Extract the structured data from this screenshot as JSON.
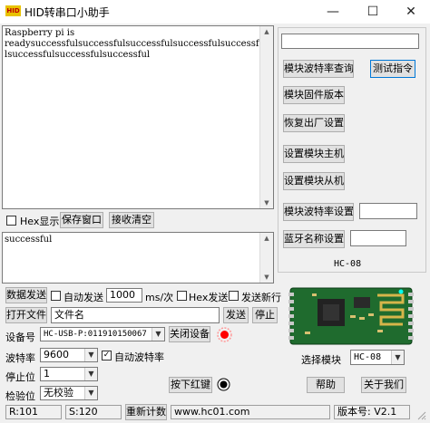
{
  "window": {
    "icon_text": "HID",
    "title": "HID转串口小助手",
    "minimize": "—",
    "maximize": "☐",
    "close": "✕"
  },
  "receive": {
    "lines": [
      "Raspberry pi is",
      "readysuccessfulsuccessfulsuccessfulsuccessfulsuccessfu",
      "lsuccessfulsuccessfulsuccessful"
    ]
  },
  "toolbar": {
    "hex_display": "Hex显示",
    "save_window": "保存窗口",
    "clear_receive": "接收清空"
  },
  "send_text": "successful",
  "send_row": {
    "data_send": "数据发送",
    "timed_send": "自动发送",
    "interval": "1000",
    "interval_unit": "ms/次",
    "hex_send": "Hex发送",
    "send_newline": "发送新行"
  },
  "file_row": {
    "open_file": "打开文件",
    "file_name": "文件名",
    "send": "发送",
    "stop": "停止"
  },
  "port": {
    "device_label": "设备号",
    "device_value": "HC-USB-P:011910150067",
    "close_device": "关闭设备",
    "baud_label": "波特率",
    "baud_value": "9600",
    "auto_baud": "自动波特率",
    "stop_label": "停止位",
    "stop_value": "1",
    "parity_label": "检验位",
    "parity_value": "无校验",
    "press_red_key": "按下红键"
  },
  "status": {
    "rx": "R:101",
    "tx": "S:120",
    "reset_count": "重新计数",
    "url": "www.hc01.com",
    "version": "版本号: V2.1"
  },
  "right": {
    "cmd_field": "",
    "query_baud": "模块波特率查询",
    "test_cmd": "测试指令",
    "firmware": "模块固件版本",
    "factory_reset": "恢复出厂设置",
    "set_master": "设置模块主机",
    "set_slave": "设置模块从机",
    "set_baud": "模块波特率设置",
    "set_baud_value": "",
    "set_bt_name": "蓝牙名称设置",
    "set_bt_name_value": "",
    "group_label": "HC-08",
    "select_module_label": "选择模块",
    "select_module_value": "HC-08",
    "help": "帮助",
    "about": "关于我们"
  },
  "colors": {
    "pcb_green": "#1f6b2e",
    "led_red": "#ff0000",
    "focus_blue": "#0078d7"
  }
}
